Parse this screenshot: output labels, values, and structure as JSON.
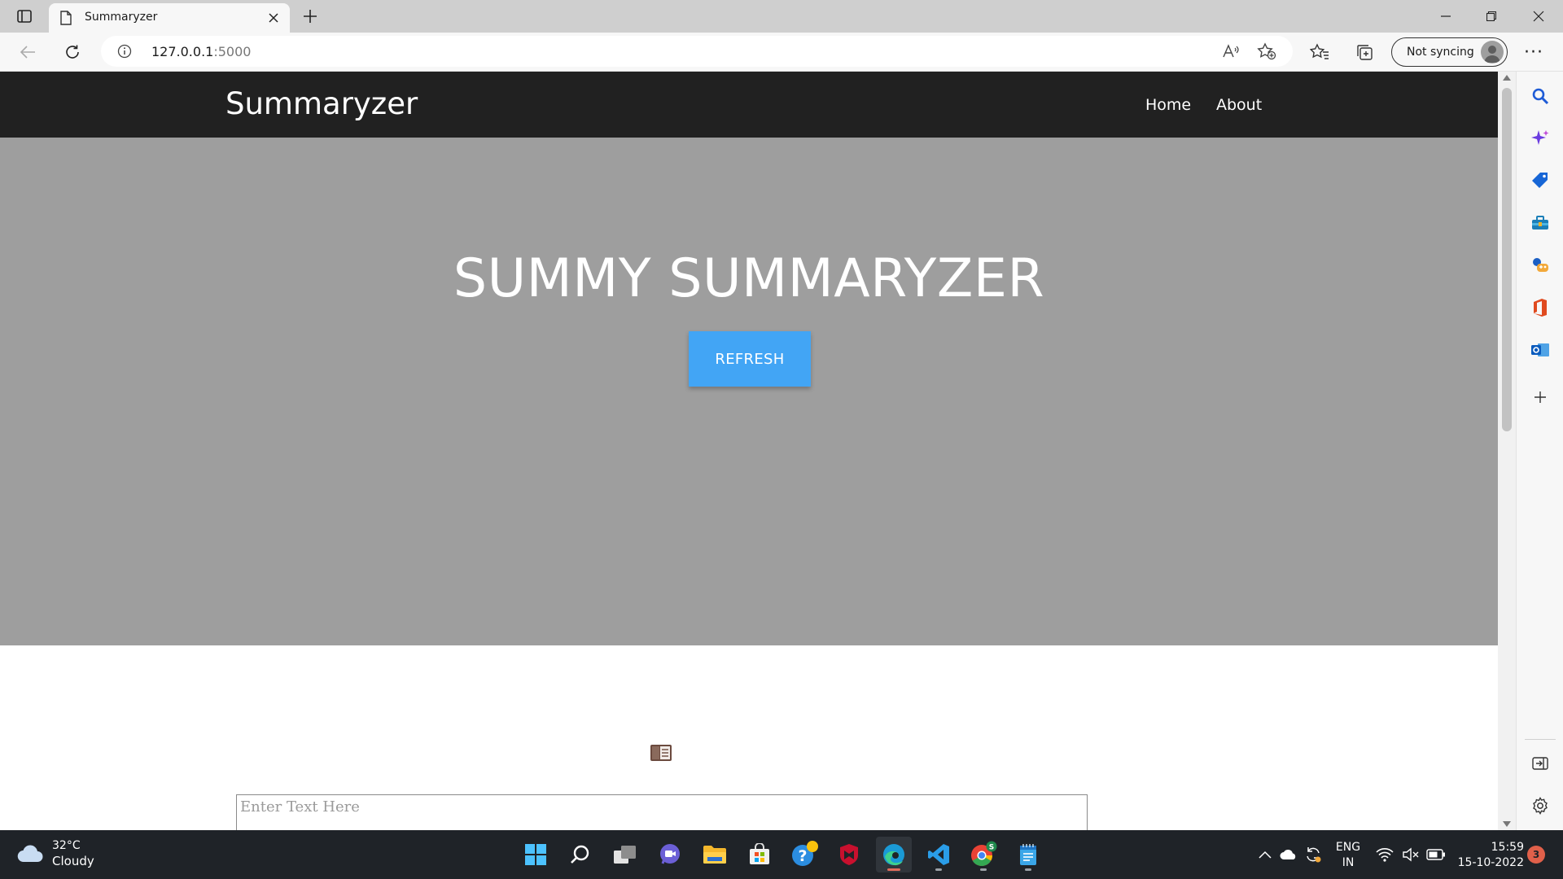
{
  "browser": {
    "tab_title": "Summaryzer",
    "url_host": "127.0.0.1",
    "url_port": ":5000",
    "profile_label": "Not syncing",
    "more_label": "···"
  },
  "page": {
    "brand": "Summaryzer",
    "nav": [
      {
        "label": "Home"
      },
      {
        "label": "About"
      }
    ],
    "hero_title": "SUMMY SUMMARYZER",
    "refresh_label": "REFRESH",
    "input_placeholder": "Enter Text Here"
  },
  "taskbar": {
    "weather_temp": "32°C",
    "weather_condition": "Cloudy",
    "lang_line1": "ENG",
    "lang_line2": "IN",
    "time": "15:59",
    "date": "15-10-2022",
    "notification_count": "3",
    "apps": [
      "start-icon",
      "search-icon",
      "task-view-icon",
      "chat-icon",
      "file-explorer-icon",
      "microsoft-store-icon",
      "get-help-icon",
      "mcafee-icon",
      "edge-icon",
      "vscode-icon",
      "chrome-icon",
      "notepad-icon"
    ]
  },
  "colors": {
    "navbar": "#212121",
    "hero": "#9e9e9e",
    "accent_button": "#42a5f5",
    "taskbar": "#1f2328"
  }
}
